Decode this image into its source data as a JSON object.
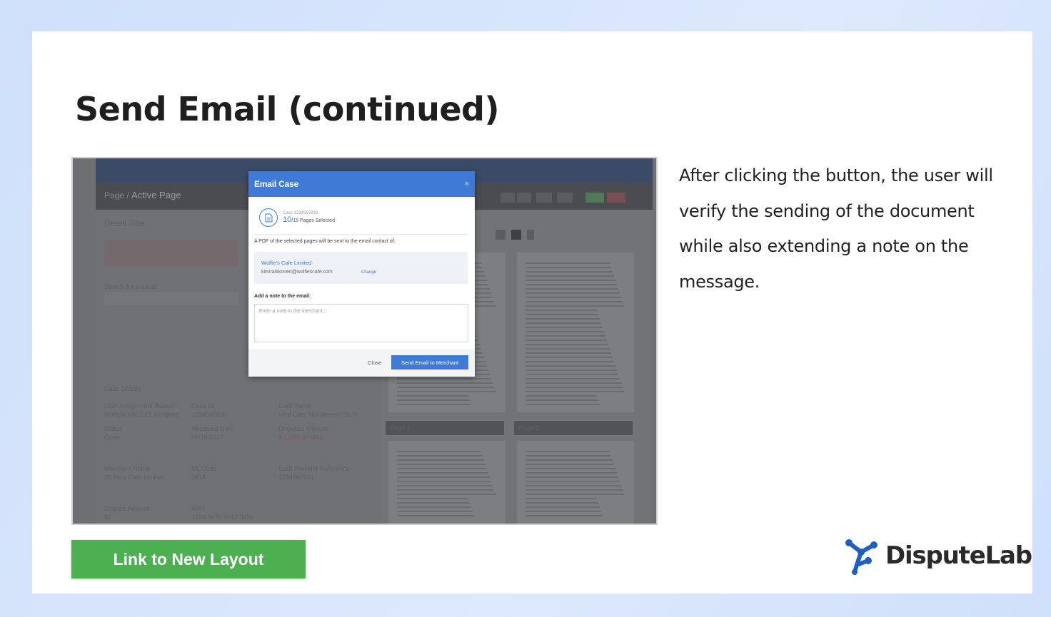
{
  "slide": {
    "title": "Send Email (continued)",
    "description": "After clicking the button, the user will verify the sending of the document while also extending a note on the message.",
    "link_button": "Link to New Layout",
    "logo_text": "DisputeLab",
    "logo_icon": "molecule-icon"
  },
  "screenshot": {
    "breadcrumb_prev": "Page",
    "breadcrumb_active": "Active Page",
    "detail_title": "Detail Title",
    "search_label": "Search for a email",
    "case_details_heading": "Case Details",
    "fields": [
      {
        "label": "User Assignment Reason",
        "value": "Multiple 6557.25 Assigned"
      },
      {
        "label": "Case ID",
        "value": "1234567890"
      },
      {
        "label": "Card Name",
        "value": "Visa Card Not present 5579"
      },
      {
        "label": "Status",
        "value": "Open"
      },
      {
        "label": "Received Date",
        "value": "01/18/2017"
      },
      {
        "label": "Disputed Amount",
        "value": "$ 1,026.00 USD"
      },
      {
        "label": "Merchant Name",
        "value": "Wolfie's Cafe Limited"
      },
      {
        "label": "MCCode",
        "value": "5814"
      },
      {
        "label": "Card Provider Reference",
        "value": "1234567891"
      },
      {
        "label": "Dispute Amount",
        "value": "$0"
      },
      {
        "label": "ARN",
        "value": "1234 5678 9012 3456"
      }
    ],
    "page_labels": [
      "Page 1",
      "Page 2"
    ]
  },
  "modal": {
    "title": "Email Case",
    "close_icon": "×",
    "case_id": "Case 1234567890",
    "pages_selected_count": "10",
    "pages_selected_suffix": "/15 Pages Selected",
    "pdf_text": "A PDF of the selected pages will be sent to the email contact of:",
    "contact_name": "Wolfie's Cafe Limited",
    "contact_email": "kimiraikkonen@wolfiescafe.com",
    "change_link": "Change",
    "note_label": "Add a note to the email:",
    "note_placeholder": "Enter a note to the merchant...",
    "close_button": "Close",
    "send_button": "Send Email to Merchant"
  },
  "colors": {
    "modal_header": "#3f7bd6",
    "link_button": "#4caf50",
    "logo_blue": "#1f5fbf"
  }
}
